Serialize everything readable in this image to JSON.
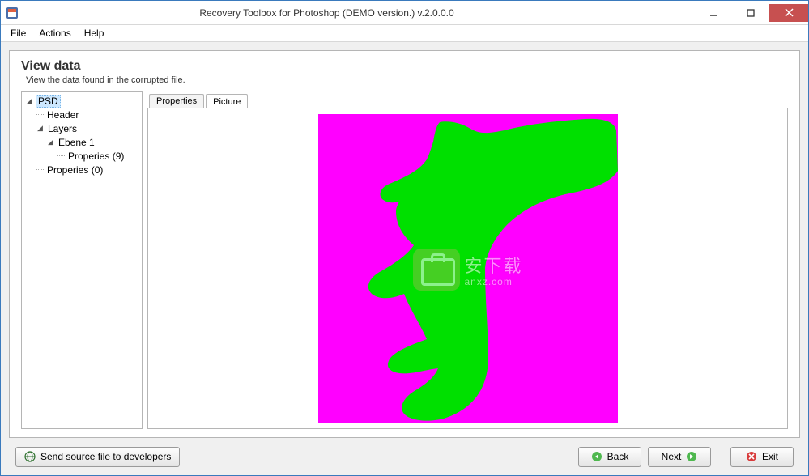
{
  "titlebar": {
    "title": "Recovery Toolbox for Photoshop (DEMO version.) v.2.0.0.0"
  },
  "menu": {
    "file": "File",
    "actions": "Actions",
    "help": "Help"
  },
  "page": {
    "heading": "View data",
    "subheading": "View the data found in the corrupted file."
  },
  "tree": {
    "root": "PSD",
    "header": "Header",
    "layers": "Layers",
    "ebene1": "Ebene 1",
    "properies9": "Properies (9)",
    "properies0": "Properies (0)"
  },
  "tabs": {
    "properties": "Properties",
    "picture": "Picture",
    "active": "picture"
  },
  "watermark": {
    "line1": "安下载",
    "line2": "anxz.com"
  },
  "footer": {
    "send": "Send source file to developers",
    "back": "Back",
    "next": "Next",
    "exit": "Exit"
  },
  "colors": {
    "magenta": "#ff00ff",
    "green": "#00e000"
  }
}
